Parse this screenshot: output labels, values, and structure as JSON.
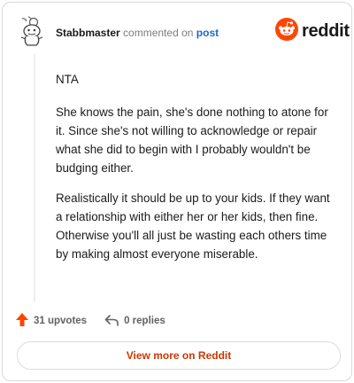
{
  "comment": {
    "username": "Stabbmaster",
    "action_text": "commented on",
    "target_link": "post",
    "paragraphs": [
      "NTA",
      "She knows the pain, she's done nothing to atone for it. Since she's not willing to acknowledge or repair what she did to begin with I probably wouldn't be budging either.",
      "Realistically it should be up to your kids. If they want a relationship with either her or her kids, then fine. Otherwise you'll all just be wasting each others time by making almost everyone miserable."
    ],
    "upvotes_label": "31 upvotes",
    "replies_label": "0 replies"
  },
  "brand": {
    "name": "reddit",
    "accent": "#ff4500"
  },
  "footer": {
    "view_more_label": "View more on Reddit"
  },
  "icons": {
    "avatar": "snoo-avatar-icon",
    "upvote": "upvote-arrow-icon",
    "reply": "reply-arrow-icon",
    "logo": "reddit-snoo-logo-icon"
  }
}
